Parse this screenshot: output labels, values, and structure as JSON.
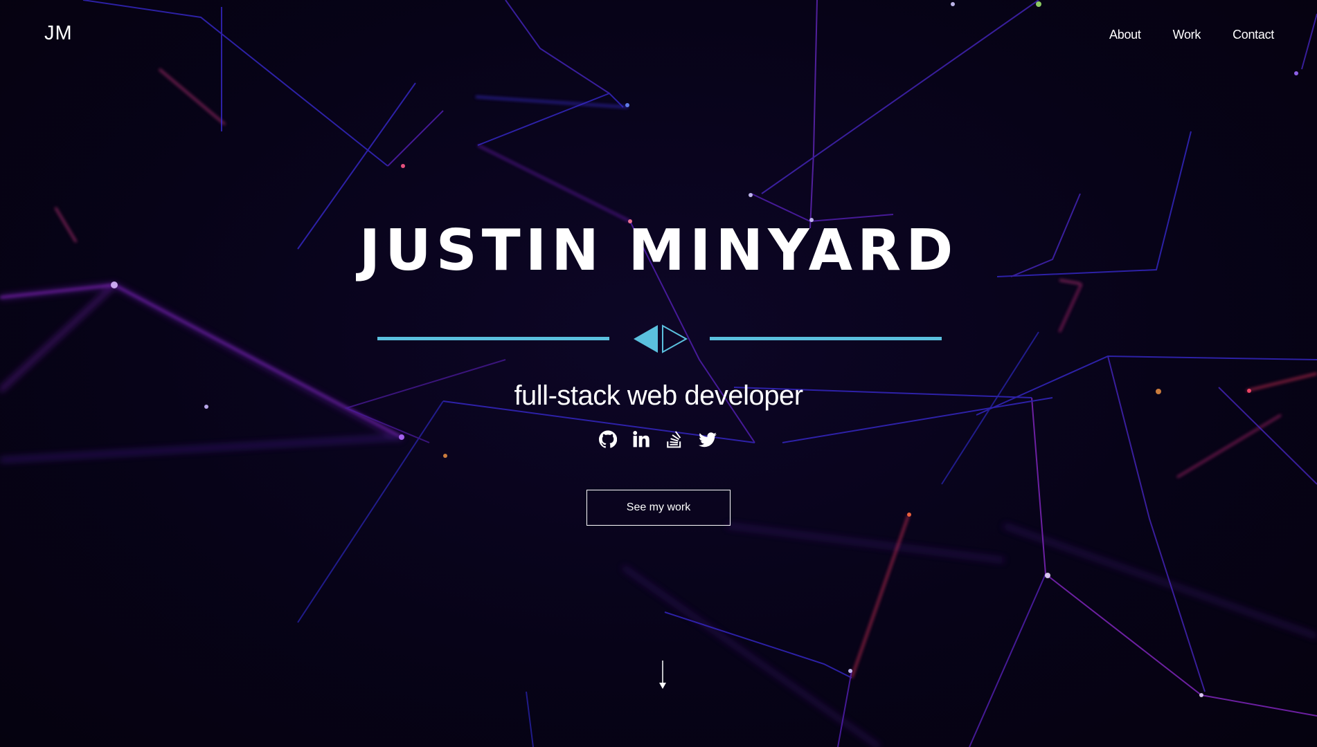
{
  "header": {
    "logo": "JM",
    "nav": [
      {
        "label": "About"
      },
      {
        "label": "Work"
      },
      {
        "label": "Contact"
      }
    ]
  },
  "hero": {
    "name": "JUSTIN MINYARD",
    "tagline": "full-stack web developer",
    "cta_label": "See my work",
    "social_icons": [
      "github-icon",
      "linkedin-icon",
      "stackoverflow-icon",
      "twitter-icon"
    ]
  },
  "colors": {
    "background": "#07031a",
    "accent": "#5bc0de",
    "text": "#ffffff",
    "network_lines": [
      "#6a1fb0",
      "#3a2bd6",
      "#b3266e"
    ]
  }
}
